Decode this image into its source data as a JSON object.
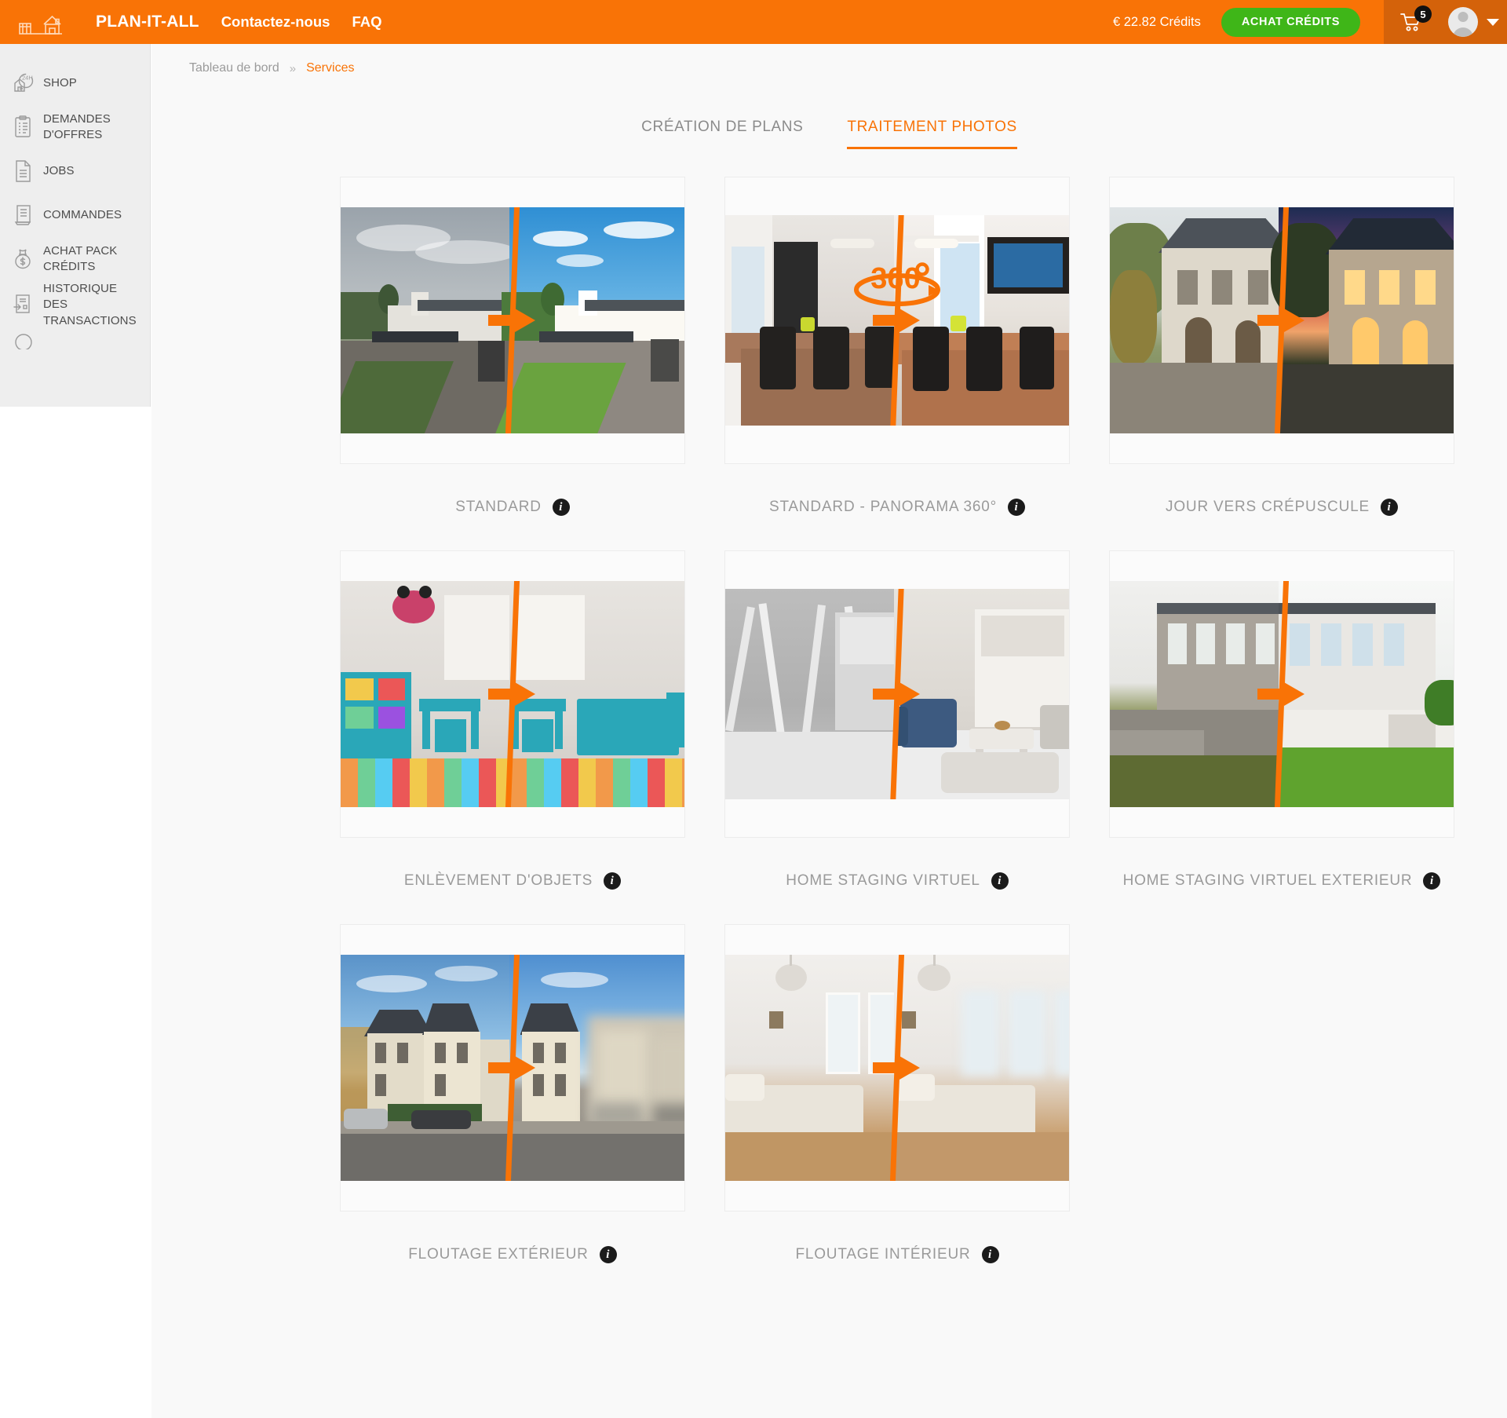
{
  "header": {
    "logo_icon": "house-blueprint-logo",
    "brand": "PLAN-IT-ALL",
    "nav": [
      {
        "label": "Contactez-nous",
        "name": "nav-contact"
      },
      {
        "label": "FAQ",
        "name": "nav-faq"
      }
    ],
    "credits": "€ 22.82 Crédits",
    "buy_credits_label": "ACHAT CRÉDITS",
    "cart_icon": "shopping-cart-icon",
    "cart_count": "5",
    "avatar_icon": "user-avatar-icon",
    "caret_icon": "chevron-down-icon",
    "accent_color": "#f97306",
    "buy_button_color": "#3fb618"
  },
  "sidebar": {
    "items": [
      {
        "label": "SHOP",
        "icon": "house-24h-icon",
        "name": "sidebar-item-shop"
      },
      {
        "label": "DEMANDES D'OFFRES",
        "icon": "clipboard-icon",
        "name": "sidebar-item-demandes-offres"
      },
      {
        "label": "JOBS",
        "icon": "document-lines-icon",
        "name": "sidebar-item-jobs"
      },
      {
        "label": "COMMANDES",
        "icon": "order-list-icon",
        "name": "sidebar-item-commandes"
      },
      {
        "label": "ACHAT PACK CRÉDITS",
        "icon": "money-bag-icon",
        "name": "sidebar-item-achat-pack-credits"
      },
      {
        "label": "HISTORIQUE DES TRANSACTIONS",
        "icon": "transaction-history-icon",
        "name": "sidebar-item-historique-transactions"
      }
    ]
  },
  "breadcrumb": {
    "root": "Tableau de bord",
    "separator": "»",
    "current": "Services"
  },
  "tabs": [
    {
      "label": "CRÉATION DE PLANS",
      "active": false,
      "name": "tab-creation-de-plans"
    },
    {
      "label": "TRAITEMENT PHOTOS",
      "active": true,
      "name": "tab-traitement-photos"
    }
  ],
  "services": [
    {
      "label": "STANDARD",
      "info": "i",
      "scene": "exterior-villa",
      "badge": ""
    },
    {
      "label": "STANDARD - PANORAMA 360°",
      "info": "i",
      "scene": "interior-dining",
      "badge": "360°"
    },
    {
      "label": "JOUR VERS CRÉPUSCULE",
      "info": "i",
      "scene": "stone-house-dusk",
      "badge": ""
    },
    {
      "label": "ENLÈVEMENT D'OBJETS",
      "info": "i",
      "scene": "kids-room",
      "badge": ""
    },
    {
      "label": "HOME STAGING VIRTUEL",
      "info": "i",
      "scene": "empty-to-staged-living",
      "badge": ""
    },
    {
      "label": "HOME STAGING VIRTUEL EXTERIEUR",
      "info": "i",
      "scene": "exterior-staging",
      "badge": ""
    },
    {
      "label": "FLOUTAGE EXTÉRIEUR",
      "info": "i",
      "scene": "street-blur",
      "badge": ""
    },
    {
      "label": "FLOUTAGE INTÉRIEUR",
      "info": "i",
      "scene": "bedroom-blur",
      "badge": ""
    }
  ]
}
